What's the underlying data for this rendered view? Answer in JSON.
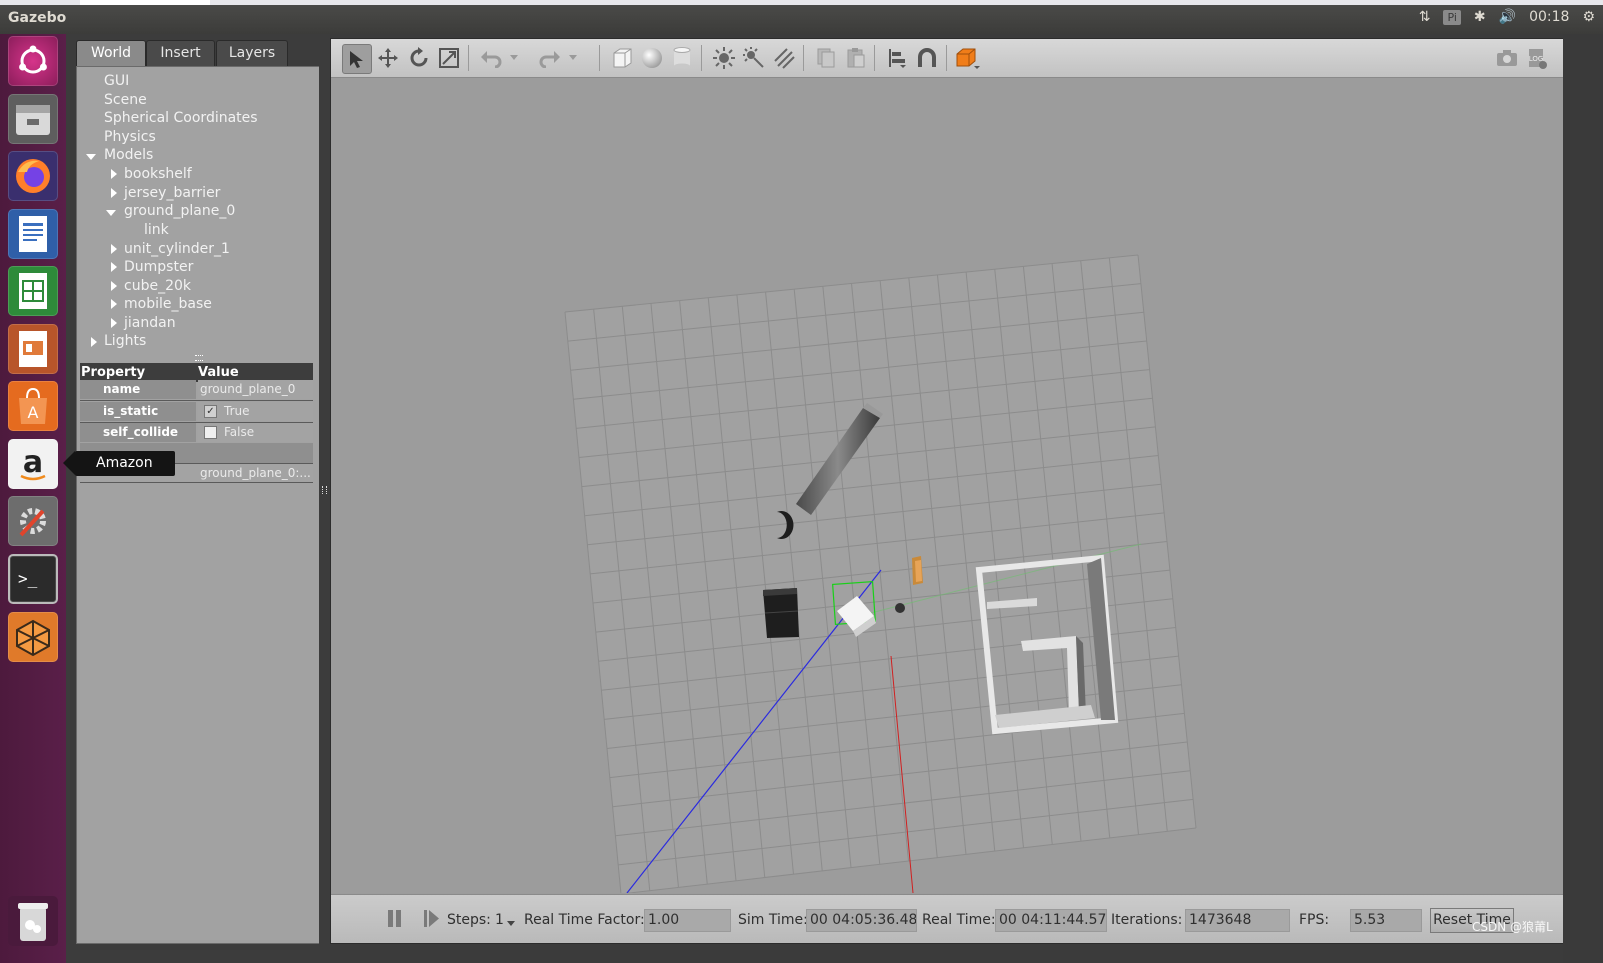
{
  "app": {
    "title": "Gazebo"
  },
  "tray": {
    "pi_label": "Pi",
    "clock": "00:18"
  },
  "launcher": {
    "tooltip": "Amazon"
  },
  "panel": {
    "tabs": [
      "World",
      "Insert",
      "Layers"
    ],
    "tree": {
      "gui": "GUI",
      "scene": "Scene",
      "spherical": "Spherical Coordinates",
      "physics": "Physics",
      "models": "Models",
      "bookshelf": "bookshelf",
      "jersey_barrier": "jersey_barrier",
      "ground_plane_0": "ground_plane_0",
      "link": "link",
      "unit_cylinder_1": "unit_cylinder_1",
      "dumpster": "Dumpster",
      "cube_20k": "cube_20k",
      "mobile_base": "mobile_base",
      "jiandan": "jiandan",
      "lights": "Lights"
    },
    "properties": {
      "header_property": "Property",
      "header_value": "Value",
      "name_label": "name",
      "name_value": "ground_plane_0",
      "is_static_label": "is_static",
      "is_static_value": "True",
      "self_collide_label": "self_collide",
      "self_collide_value": "False",
      "link_row_value": "ground_plane_0:..."
    }
  },
  "bottom": {
    "steps_label": "Steps:",
    "steps_value": "1",
    "rtf_label": "Real Time Factor:",
    "rtf_value": "1.00",
    "sim_label": "Sim Time:",
    "sim_value": "00 04:05:36.480",
    "real_label": "Real Time:",
    "real_value": "00 04:11:44.572",
    "iter_label": "Iterations:",
    "iter_value": "1473648",
    "fps_label": "FPS:",
    "fps_value": "5.53",
    "reset_label": "Reset Time"
  },
  "watermark": "CSDN @狼莆L",
  "icons": [
    "ubuntu-logo-icon",
    "files-icon",
    "firefox-icon",
    "writer-icon",
    "calc-icon",
    "impress-icon",
    "software-center-icon",
    "amazon-icon",
    "settings-icon",
    "terminal-icon",
    "gazebo-icon",
    "trash-icon",
    "select-icon",
    "translate-icon",
    "rotate-icon",
    "scale-icon",
    "undo-icon",
    "redo-icon",
    "box-icon",
    "sphere-icon",
    "cylinder-icon",
    "point-light-icon",
    "spot-light-icon",
    "directional-light-icon",
    "copy-icon",
    "paste-icon",
    "align-icon",
    "snap-icon",
    "view-angle-icon",
    "screenshot-icon",
    "log-icon",
    "pause-icon",
    "step-icon"
  ],
  "colors": {
    "accent_orange": "#f07d19",
    "launcher_bg": "#5a1f49",
    "grid_line": "#8c8c8c",
    "selection_green": "#19d019"
  }
}
